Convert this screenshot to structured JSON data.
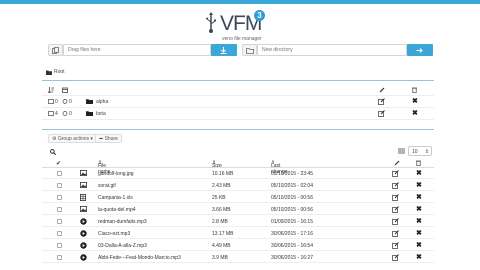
{
  "colors": {
    "accent": "#3aa7d8",
    "divider": "#8fc6e0"
  },
  "logo": {
    "title": "VFM",
    "badge": "3",
    "subtitle": "veno file manager"
  },
  "upload": {
    "placeholder": "Drag files here"
  },
  "new_directory": {
    "placeholder": "New directory"
  },
  "breadcrumb": {
    "root_label": "Root"
  },
  "folders": [
    {
      "files": "0",
      "folders": "0",
      "name": "alpha"
    },
    {
      "files": "4",
      "folders": "0",
      "name": "beta"
    }
  ],
  "toolbar": {
    "group_actions": "Group actions",
    "share": "Share",
    "per_page": "10"
  },
  "file_columns": {
    "name": "File name",
    "size": "Size",
    "date": "Last change"
  },
  "files": [
    {
      "icon": "image-icon",
      "name": "gandolf-long.jpg",
      "size": "10.16 MB",
      "date": "05/10/2015 - 23:45"
    },
    {
      "icon": "image-icon",
      "name": "sorat.gif",
      "size": "2.43 MB",
      "date": "05/10/2015 - 02:04"
    },
    {
      "icon": "spreadsheet-icon",
      "name": "Campania-1.xls",
      "size": "25 KB",
      "date": "05/10/2015 - 00:56"
    },
    {
      "icon": "image-icon",
      "name": "la-quota-del.mp4",
      "size": "3.66 MB",
      "date": "05/10/2015 - 00:56"
    },
    {
      "icon": "play-icon",
      "name": "redman-dumfaits.mp3",
      "size": "2.8 MB",
      "date": "01/09/2015 - 16:15"
    },
    {
      "icon": "play-icon",
      "name": "Ciaco-ezt.mp3",
      "size": "13.17 MB",
      "date": "30/06/2015 - 17:16"
    },
    {
      "icon": "play-icon",
      "name": "03-Dalla-A-alla-Z.mp3",
      "size": "4.49 MB",
      "date": "30/06/2015 - 16:54"
    },
    {
      "icon": "play-icon",
      "name": "Abbi-Fede---Feat-Mondo-Marcio.mp3",
      "size": "3.9 MB",
      "date": "30/06/2015 - 16:27"
    }
  ]
}
